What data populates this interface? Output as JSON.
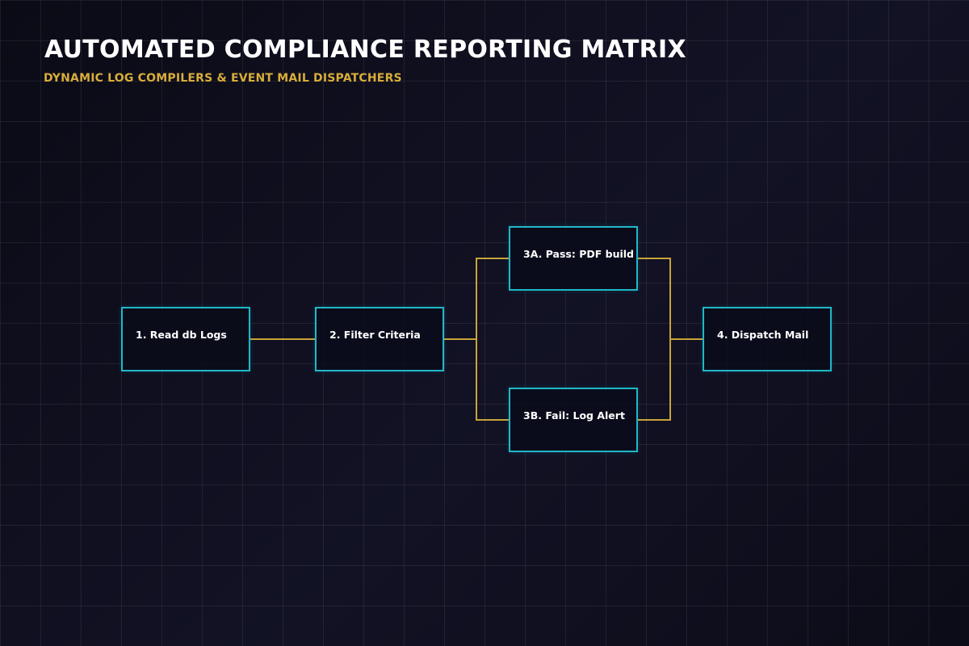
{
  "header": {
    "title": "AUTOMATED COMPLIANCE REPORTING MATRIX",
    "subtitle": "DYNAMIC LOG COMPILERS & EVENT MAIL DISPATCHERS"
  },
  "colors": {
    "background": "#0d0d19",
    "node_border": "#1fb8c8",
    "connector": "#c9a338",
    "subtitle": "#d8ad3a",
    "text": "#ffffff"
  },
  "nodes": [
    {
      "id": "read",
      "label": "1. Read db Logs"
    },
    {
      "id": "filter",
      "label": "2. Filter Criteria"
    },
    {
      "id": "pass",
      "label": "3A. Pass: PDF build"
    },
    {
      "id": "fail",
      "label": "3B. Fail: Log Alert"
    },
    {
      "id": "dispatch",
      "label": "4. Dispatch Mail"
    }
  ],
  "edges": [
    {
      "from": "read",
      "to": "filter"
    },
    {
      "from": "filter",
      "to": "pass"
    },
    {
      "from": "filter",
      "to": "fail"
    },
    {
      "from": "pass",
      "to": "dispatch"
    },
    {
      "from": "fail",
      "to": "dispatch"
    }
  ]
}
